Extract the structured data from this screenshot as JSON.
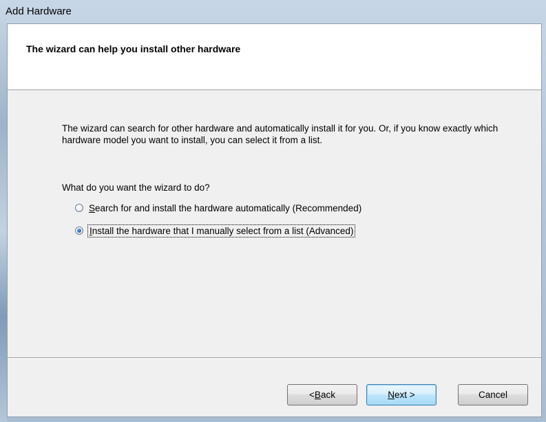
{
  "window": {
    "title": "Add Hardware"
  },
  "header": {
    "title": "The wizard can help you install other hardware"
  },
  "body": {
    "description": "The wizard can search for other hardware and automatically install it for you. Or, if you know exactly which hardware model you want to install, you can select it from a list.",
    "question": "What do you want the wizard to do?",
    "options": [
      {
        "label": "Search for and install the hardware automatically (Recommended)",
        "accel": "S",
        "rest": "earch for and install the hardware automatically (Recommended)",
        "selected": false
      },
      {
        "label": "Install the hardware that I manually select from a list (Advanced)",
        "accel": "I",
        "rest": "nstall the hardware that I manually select from a list (Advanced)",
        "selected": true
      }
    ]
  },
  "buttons": {
    "back": {
      "label": "< Back",
      "prefix": "< ",
      "accel": "B",
      "rest": "ack"
    },
    "next": {
      "label": "Next >",
      "accel": "N",
      "rest": "ext >"
    },
    "cancel": {
      "label": "Cancel"
    }
  },
  "colors": {
    "header_bg": "#ffffff",
    "client_bg": "#f0f0f0",
    "default_button_border": "#3c7fb1"
  }
}
